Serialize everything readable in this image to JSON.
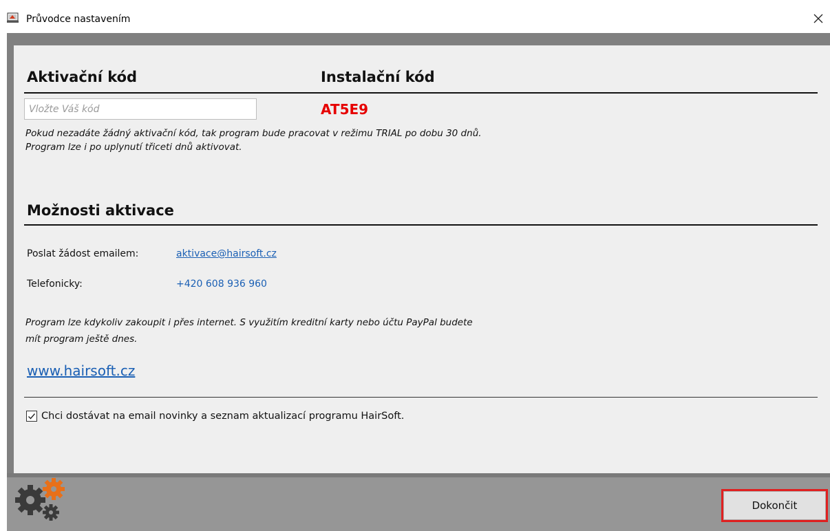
{
  "window": {
    "title": "Průvodce nastavením",
    "close_icon": "close-icon"
  },
  "activation": {
    "heading": "Aktivační kód",
    "input_placeholder": "Vložte Váš kód",
    "input_value": ""
  },
  "installation": {
    "heading": "Instalační kód",
    "code": "AT5E9",
    "code_color": "#e60000"
  },
  "trial_note": {
    "line1": "Pokud nezadáte žádný aktivační kód, tak program bude pracovat v režimu TRIAL po dobu 30 dnů.",
    "line2": "Program lze i po uplynutí třiceti dnů aktivovat."
  },
  "options": {
    "heading": "Možnosti aktivace",
    "email_label": "Poslat žádost emailem:",
    "email_link": "aktivace@hairsoft.cz",
    "phone_label": "Telefonicky:",
    "phone_value": "+420 608 936 960",
    "purchase_note_line1": "Program lze kdykoliv zakoupit i přes internet. S využitím kreditní karty nebo účtu PayPal budete",
    "purchase_note_line2": "mít program ještě dnes.",
    "website": "www.hairsoft.cz"
  },
  "newsletter": {
    "checked": true,
    "label": "Chci dostávat na email novinky a seznam aktualizací programu HairSoft."
  },
  "footer": {
    "logo_icon": "gears-icon",
    "finish_label": "Dokončit"
  },
  "colors": {
    "accent_link": "#1a5fb4",
    "highlight_border": "#e02020",
    "gear_orange": "#e8701a"
  }
}
